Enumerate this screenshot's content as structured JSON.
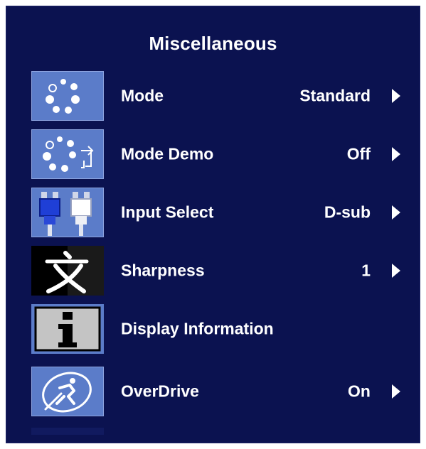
{
  "header": {
    "title": "Miscellaneous"
  },
  "colors": {
    "background": "#0b1250",
    "icon_blue": "#5b7cc9",
    "text": "#ffffff"
  },
  "menu": {
    "items": [
      {
        "label": "Mode",
        "value": "Standard",
        "icon": "mode-dots-icon",
        "has_arrow": true
      },
      {
        "label": "Mode Demo",
        "value": "Off",
        "icon": "mode-demo-icon",
        "has_arrow": true
      },
      {
        "label": "Input Select",
        "value": "D-sub",
        "icon": "input-connectors-icon",
        "has_arrow": true
      },
      {
        "label": "Sharpness",
        "value": "1",
        "icon": "sharpness-character-icon",
        "has_arrow": true
      },
      {
        "label": "Display Information",
        "value": "",
        "icon": "information-icon",
        "has_arrow": false
      },
      {
        "label": "OverDrive",
        "value": "On",
        "icon": "overdrive-runner-icon",
        "has_arrow": true
      }
    ]
  }
}
